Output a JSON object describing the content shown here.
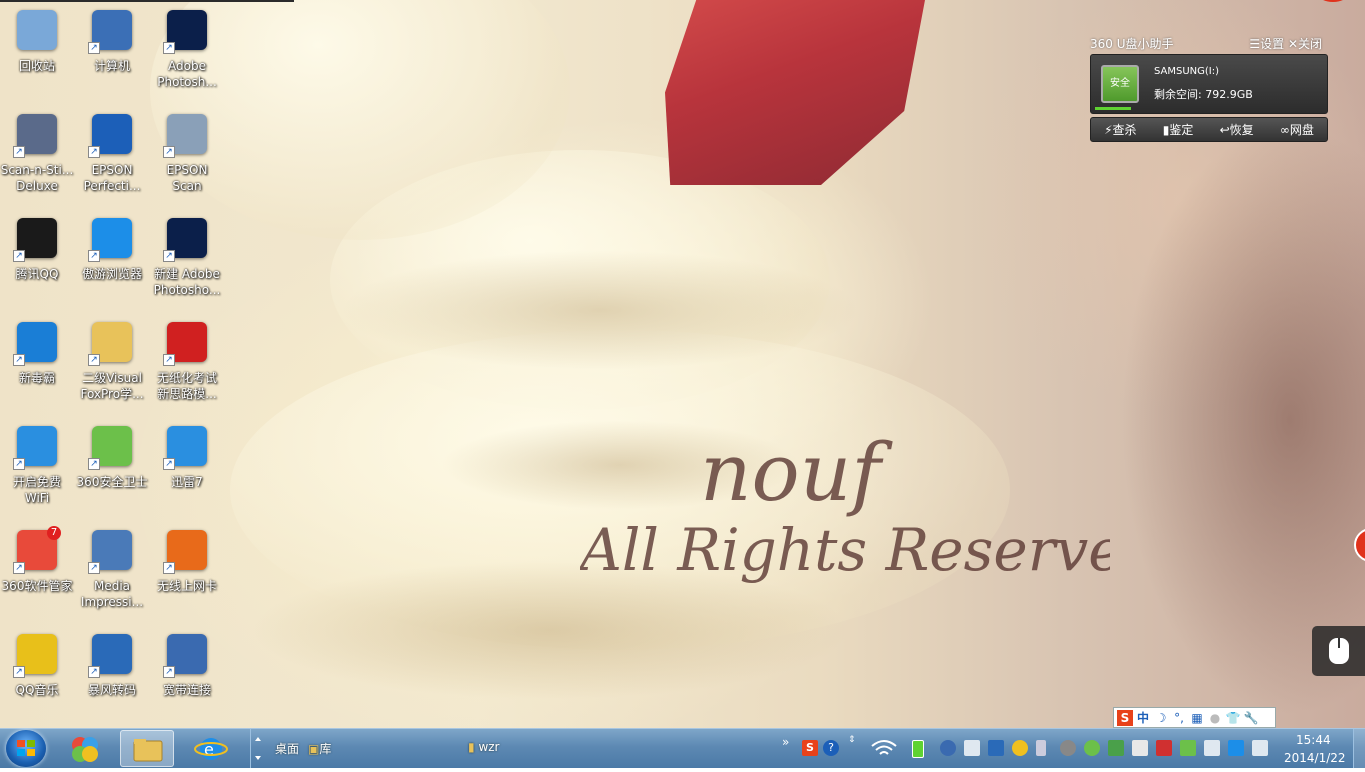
{
  "desktop": {
    "icons": [
      {
        "label": "回收站",
        "icon": "recycle-bin-icon",
        "color": "#7aa8d8"
      },
      {
        "label": "计算机",
        "icon": "computer-icon",
        "color": "#3b6fb6"
      },
      {
        "label": "Adobe\nPhotosh...",
        "icon": "photoshop-icon",
        "color": "#0b1f4a"
      },
      {
        "label": "Scan-n-Sti...\nDeluxe",
        "icon": "scanner-icon",
        "color": "#5a6a8a"
      },
      {
        "label": "EPSON\nPerfecti...",
        "icon": "epson-perfection-icon",
        "color": "#1c5fb8"
      },
      {
        "label": "EPSON\nScan",
        "icon": "epson-scan-icon",
        "color": "#8aa0b8"
      },
      {
        "label": "腾讯QQ",
        "icon": "qq-penguin-icon",
        "color": "#1a1a1a"
      },
      {
        "label": "傲游浏览器",
        "icon": "maxthon-browser-icon",
        "color": "#1c8ee8"
      },
      {
        "label": "新建 Adobe\nPhotosho...",
        "icon": "psd-file-icon",
        "color": "#0b1f4a"
      },
      {
        "label": "新毒霸",
        "icon": "duba-antivirus-icon",
        "color": "#1a7ed6"
      },
      {
        "label": "二级Visual\nFoxPro学...",
        "icon": "folder-icon",
        "color": "#e8c25a"
      },
      {
        "label": "无纸化考试\n新思路模...",
        "icon": "ncr-exam-icon",
        "color": "#d02020"
      },
      {
        "label": "开启免费\nWiFi",
        "icon": "wifi-icon",
        "color": "#2a8fe0"
      },
      {
        "label": "360安全卫士",
        "icon": "360-safe-icon",
        "color": "#6cc04a"
      },
      {
        "label": "迅雷7",
        "icon": "thunder-bird-icon",
        "color": "#2a8fe0"
      },
      {
        "label": "360软件管家",
        "icon": "360-software-icon",
        "color": "#e84a3a",
        "badge": "7"
      },
      {
        "label": "Media\nImpressi...",
        "icon": "media-impression-icon",
        "color": "#4a7ab8"
      },
      {
        "label": "无线上网卡",
        "icon": "wo-wireless-icon",
        "color": "#e86a1a"
      },
      {
        "label": "QQ音乐",
        "icon": "qq-music-icon",
        "color": "#e8c01a"
      },
      {
        "label": "暴风转码",
        "icon": "storm-codec-icon",
        "color": "#2a6ab8"
      },
      {
        "label": "宽带连接",
        "icon": "broadband-icon",
        "color": "#3a6ab0"
      }
    ]
  },
  "wallpaper": {
    "watermark_line1": "nouf",
    "watermark_line2": "All Rights Reserved"
  },
  "usb_helper": {
    "title": "360 U盘小助手",
    "settings": "☰设置",
    "close": "✕关闭",
    "status": "安全",
    "drive_name": "SAMSUNG(I:)",
    "free_space": "剩余空间: 792.9GB",
    "actions": [
      "查杀",
      "鉴定",
      "恢复",
      "网盘"
    ]
  },
  "ime": {
    "items": [
      "S",
      "中",
      "☽",
      "°,",
      "▦",
      "●",
      "👕",
      "🔧"
    ]
  },
  "taskbar": {
    "toolbar_desktop": "桌面",
    "toolbar_library": "库",
    "folder_wzr": "wzr",
    "time": "15:44",
    "date": "2014/1/22"
  },
  "colors": {
    "taskbar": "#5d89b3",
    "usb_green": "#5fd332",
    "wafer": "#b8343c"
  }
}
